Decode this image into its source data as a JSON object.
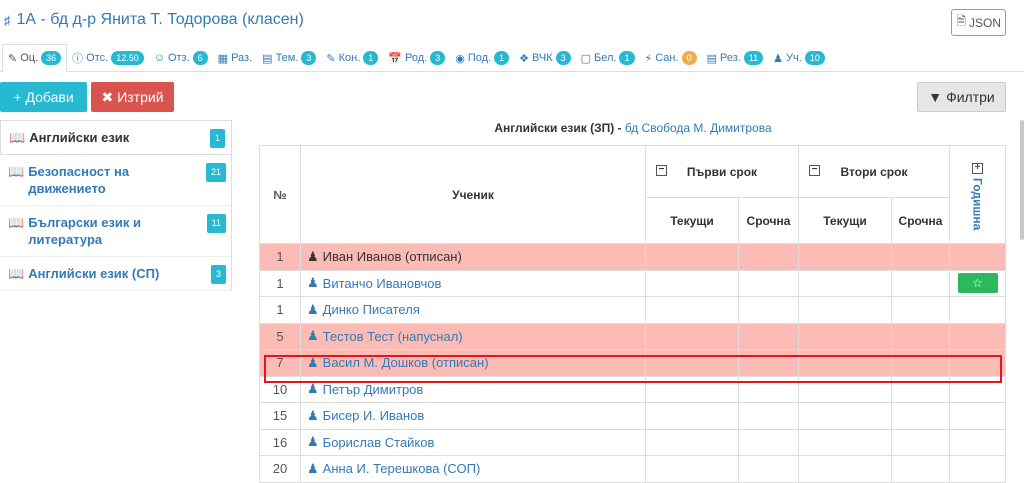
{
  "header": {
    "title": "1А - бд д-р Янита Т. Тодорова (класен)",
    "json_label": "JSON"
  },
  "tabs": [
    {
      "label": "Оц.",
      "count": "36"
    },
    {
      "label": "Отс.",
      "count": "12.50"
    },
    {
      "label": "Отз.",
      "count": "6"
    },
    {
      "label": "Раз.",
      "count": ""
    },
    {
      "label": "Тем.",
      "count": "3"
    },
    {
      "label": "Кон.",
      "count": "1"
    },
    {
      "label": "Род.",
      "count": "3"
    },
    {
      "label": "Под.",
      "count": "1"
    },
    {
      "label": "ВЧК",
      "count": "3"
    },
    {
      "label": "Бел.",
      "count": "1"
    },
    {
      "label": "Сан.",
      "count": "0"
    },
    {
      "label": "Рез.",
      "count": "11"
    },
    {
      "label": "Уч.",
      "count": "10"
    }
  ],
  "toolbar": {
    "add_label": "Добави",
    "delete_label": "Изтрий",
    "filter_label": "Филтри"
  },
  "subjects": [
    {
      "label": "Английски език",
      "count": "1"
    },
    {
      "label": "Безопасност на движението",
      "count": "21"
    },
    {
      "label": "Български език и литература",
      "count": "11"
    },
    {
      "label": "Английски език (СП)",
      "count": "3"
    }
  ],
  "main": {
    "subject_title": "Английски език (ЗП) - ",
    "teacher": "бд Свобода М. Димитрова"
  },
  "table": {
    "col_num": "№",
    "col_student": "Ученик",
    "term1": "Първи срок",
    "term2": "Втори срок",
    "current": "Текущи",
    "final": "Срочна",
    "annual": "Годишна",
    "rows": [
      {
        "num": "1",
        "name": "Иван Иванов (отписан)"
      },
      {
        "num": "1",
        "name": "Витанчо Ивановчов"
      },
      {
        "num": "1",
        "name": "Динко Писателя"
      },
      {
        "num": "5",
        "name": "Тестов Тест (напуснал)"
      },
      {
        "num": "7",
        "name": "Васил М. Дошков (отписан)"
      },
      {
        "num": "10",
        "name": "Петър Димитров"
      },
      {
        "num": "15",
        "name": "Бисер И. Иванов"
      },
      {
        "num": "16",
        "name": "Борислав Стайков"
      },
      {
        "num": "20",
        "name": "Анна И. Терешкова (СОП)"
      }
    ]
  },
  "colors": {
    "accent": "#27b8d2",
    "danger": "#d9534f",
    "withdrawn_row": "#fcbcb5",
    "highlight": "#e3161c"
  }
}
